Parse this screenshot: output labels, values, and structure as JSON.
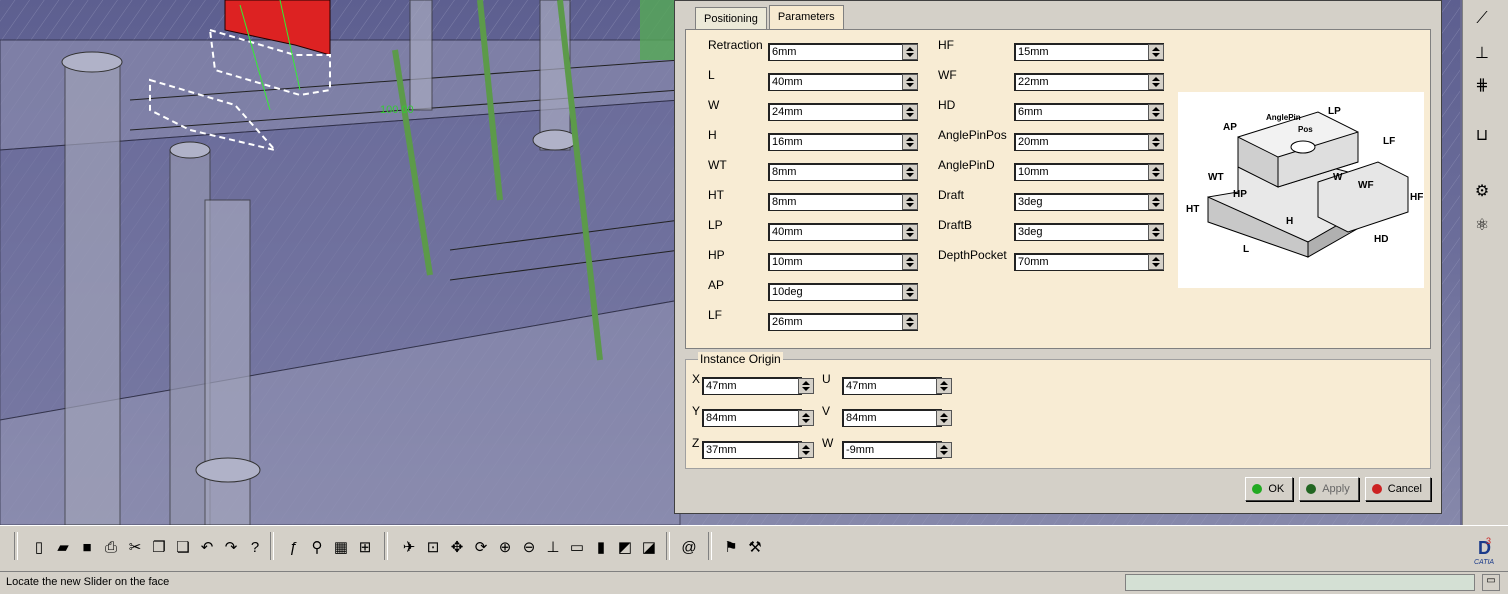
{
  "dialog": {
    "tabs": [
      {
        "label": "Positioning",
        "active": false
      },
      {
        "label": "Parameters",
        "active": true
      }
    ],
    "parameters_left": [
      {
        "label": "Retraction",
        "value": "6mm"
      },
      {
        "label": "L",
        "value": "40mm"
      },
      {
        "label": "W",
        "value": "24mm"
      },
      {
        "label": "H",
        "value": "16mm"
      },
      {
        "label": "WT",
        "value": "8mm"
      },
      {
        "label": "HT",
        "value": "8mm"
      },
      {
        "label": "LP",
        "value": "40mm"
      },
      {
        "label": "HP",
        "value": "10mm"
      },
      {
        "label": "AP",
        "value": "10deg"
      },
      {
        "label": "LF",
        "value": "26mm"
      }
    ],
    "parameters_right": [
      {
        "label": "HF",
        "value": "15mm"
      },
      {
        "label": "WF",
        "value": "22mm"
      },
      {
        "label": "HD",
        "value": "6mm"
      },
      {
        "label": "AnglePinPos",
        "value": "20mm"
      },
      {
        "label": "AnglePinD",
        "value": "10mm"
      },
      {
        "label": "Draft",
        "value": "3deg"
      },
      {
        "label": "DraftB",
        "value": "3deg"
      },
      {
        "label": "DepthPocket",
        "value": "70mm"
      }
    ],
    "preview_labels": {
      "AP": "AP",
      "LP": "LP",
      "LF": "LF",
      "WT": "WT",
      "HP": "HP",
      "W": "W",
      "WF": "WF",
      "HF": "HF",
      "HT": "HT",
      "H": "H",
      "L": "L",
      "HD": "HD",
      "AnglePin": "AnglePin",
      "AnglePinPos": "Pos"
    },
    "instance_origin": {
      "title": "Instance Origin",
      "fields": [
        {
          "label": "X",
          "value": "47mm"
        },
        {
          "label": "U",
          "value": "47mm"
        },
        {
          "label": "Y",
          "value": "84mm"
        },
        {
          "label": "V",
          "value": "84mm"
        },
        {
          "label": "Z",
          "value": "37mm"
        },
        {
          "label": "W",
          "value": "-9mm"
        }
      ]
    },
    "buttons": {
      "ok": "OK",
      "apply": "Apply",
      "cancel": "Cancel"
    }
  },
  "viewport": {
    "dimension_label": "100.00"
  },
  "statusbar": {
    "message": "Locate the new Slider on the face"
  },
  "colors": {
    "ok": "#22aa22",
    "apply": "#226622",
    "cancel": "#cc2222"
  },
  "toolbar_icons": [
    "new-icon",
    "open-icon",
    "save-icon",
    "print-icon",
    "cut-icon",
    "copy-icon",
    "paste-icon",
    "undo-icon",
    "redo-icon",
    "whats-this-icon",
    "formula-icon",
    "knowledge-icon",
    "table-icon",
    "tree-icon",
    "fly-mode-icon",
    "fit-all-icon",
    "pan-icon",
    "rotate-icon",
    "zoom-in-icon",
    "zoom-out-icon",
    "normal-view-icon",
    "view-mode-icon",
    "render-style-icon",
    "hide-show-icon",
    "swap-visible-icon",
    "refresh-icon",
    "catalog-icon",
    "slider-icon"
  ]
}
